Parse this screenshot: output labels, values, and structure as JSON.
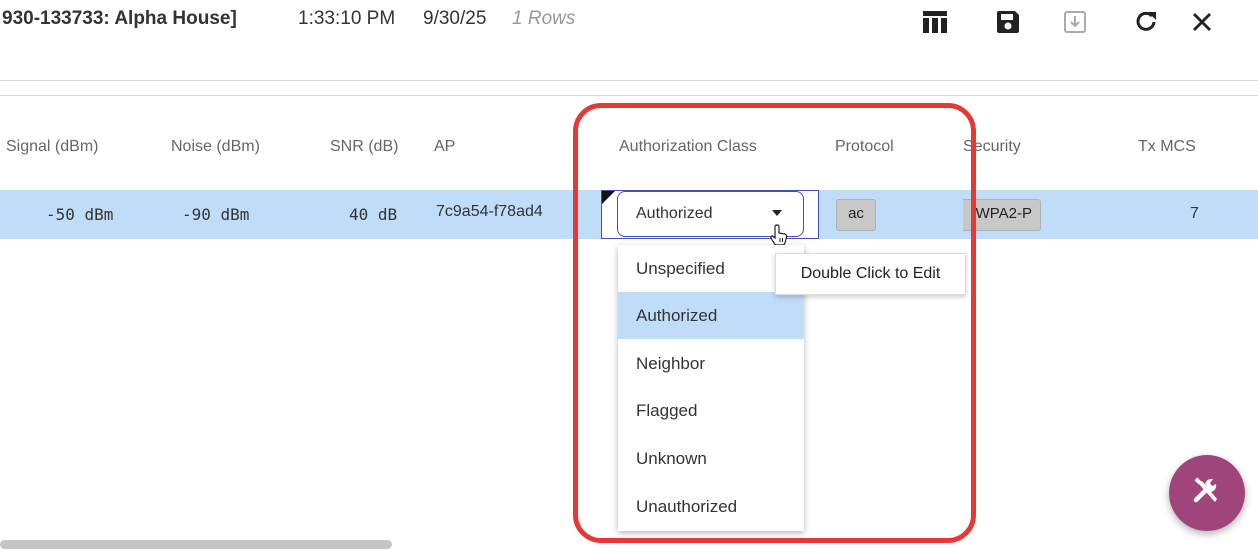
{
  "header": {
    "title": "930-133733: Alpha House]",
    "time": "1:33:10 PM",
    "date": "9/30/25",
    "rows": "1 Rows"
  },
  "toolbar": {
    "icons": [
      "columns-icon",
      "save-icon",
      "export-icon",
      "refresh-icon",
      "close-icon"
    ]
  },
  "table": {
    "columns": [
      "Signal (dBm)",
      "Noise (dBm)",
      "SNR (dB)",
      "AP",
      "Authorization Class",
      "Protocol",
      "Security",
      "Tx MCS"
    ],
    "row": {
      "signal": "-50 dBm",
      "noise": "-90 dBm",
      "snr": "40 dB",
      "ap": "7c9a54-f78ad4",
      "authorization_class": "Authorized",
      "protocol": "ac",
      "security": "WPA2-P",
      "tx_mcs": "7"
    }
  },
  "dropdown": {
    "options": [
      "Unspecified",
      "Authorized",
      "Neighbor",
      "Flagged",
      "Unknown",
      "Unauthorized"
    ],
    "selected": "Authorized"
  },
  "tooltip": "Double Click to Edit",
  "colors": {
    "row_selected": "#bfdcf8",
    "highlight": "#e53935",
    "fab": "#a0457b",
    "editor_border": "#3f51b5"
  }
}
